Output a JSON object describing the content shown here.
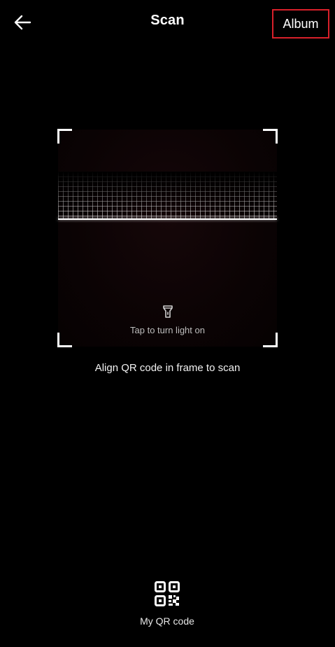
{
  "header": {
    "title": "Scan",
    "album_label": "Album",
    "back_icon": "arrow-left-icon",
    "highlight_color": "#d8202a"
  },
  "scanner": {
    "torch_label": "Tap to turn light on",
    "torch_icon": "flashlight-icon",
    "hint": "Align QR code in frame to scan"
  },
  "footer": {
    "my_qr_label": "My QR code",
    "my_qr_icon": "qr-code-icon"
  }
}
